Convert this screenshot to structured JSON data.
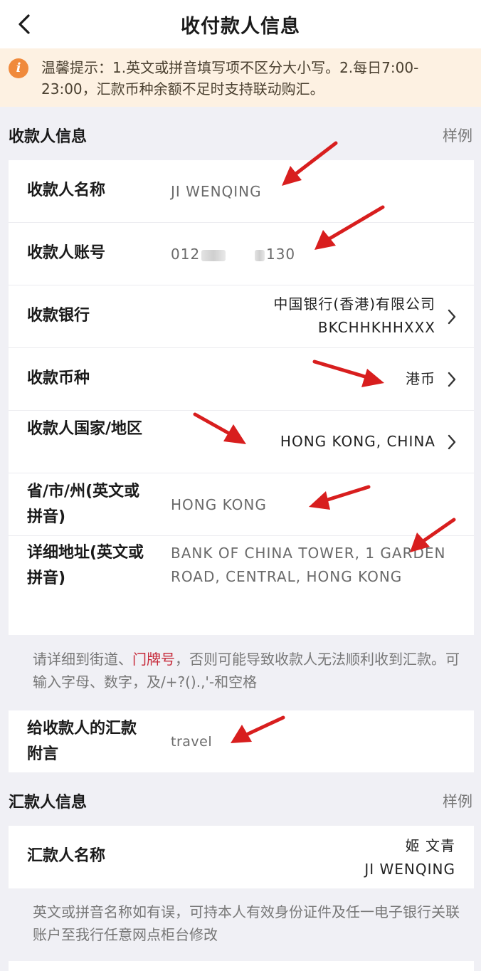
{
  "nav": {
    "title": "收付款人信息"
  },
  "tip": {
    "text": "温馨提示：1.英文或拼音填写项不区分大小写。2.每日7:00-23:00，汇款币种余额不足时支持联动购汇。"
  },
  "payee": {
    "section_title": "收款人信息",
    "example_label": "样例",
    "rows": [
      {
        "label": "收款人名称",
        "value": "JI WENQING"
      },
      {
        "label": "收款人账号",
        "value_prefix": "012",
        "value_suffix": "130"
      },
      {
        "label": "收款银行",
        "value_line1": "中国银行(香港)有限公司",
        "value_line2": "BKCHHKHHXXX"
      },
      {
        "label": "收款币种",
        "value": "港币"
      },
      {
        "label": "收款人国家/地区",
        "value": "HONG KONG, CHINA"
      },
      {
        "label": "省/市/州(英文或拼音)",
        "value": "HONG KONG"
      },
      {
        "label": "详细地址(英文或拼音)",
        "value": "BANK OF CHINA TOWER, 1 GARDEN ROAD, CENTRAL, HONG KONG"
      }
    ],
    "address_note_before": "请详细到街道、",
    "address_note_highlight": "门牌号",
    "address_note_after": "，否则可能导致收款人无法顺利收到汇款。可输入字母、数字，及/+?().,'-和空格"
  },
  "message": {
    "label": "给收款人的汇款附言",
    "value": "travel"
  },
  "payer": {
    "section_title": "汇款人信息",
    "example_label": "样例",
    "name_label": "汇款人名称",
    "name_cn": "姬 文青",
    "name_en": "JI WENQING",
    "note": "英文或拼音名称如有误，可持本人有效身份证件及任一电子银行关联账户至我行任意网点柜台修改"
  },
  "colors": {
    "accent_red": "#d81e1e",
    "tip_bg": "#fdf1e2",
    "info_icon": "#f08a3c",
    "highlight": "#c62a3a"
  },
  "icons": {
    "back": "chevron-left-icon",
    "info": "info-icon",
    "row_chevron": "chevron-right-icon",
    "annotation": "red-arrow-icon"
  }
}
